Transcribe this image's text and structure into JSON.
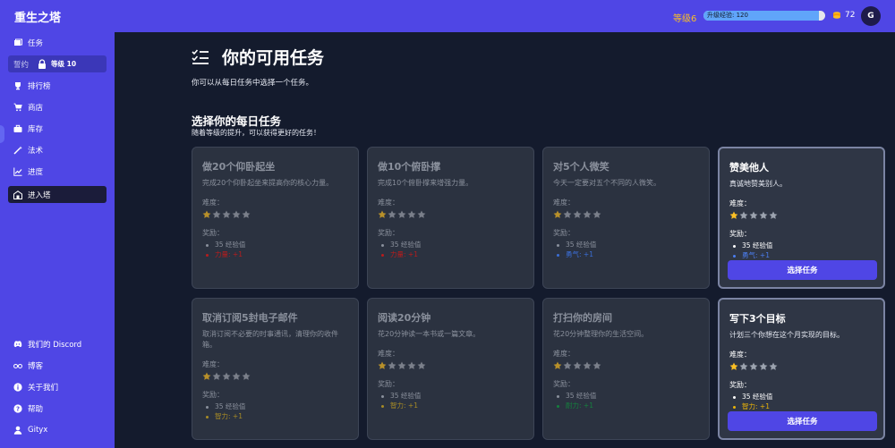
{
  "app": {
    "title": "重生之塔"
  },
  "header": {
    "level": "等级6",
    "xp_text": "升级经验: 120",
    "xp_progress": 0.95,
    "coins": "72",
    "avatar_initial": "G",
    "colors": {
      "bar": "#4f46e5",
      "level": "#fbbf24"
    }
  },
  "sidebar": {
    "items": [
      {
        "label": "任务",
        "icon": "tasks-icon"
      },
      {
        "label": "誓约",
        "icon": "lock-icon",
        "locked_level": "等级 10"
      },
      {
        "label": "排行榜",
        "icon": "trophy-icon"
      },
      {
        "label": "商店",
        "icon": "cart-icon"
      },
      {
        "label": "库存",
        "icon": "briefcase-icon"
      },
      {
        "label": "法术",
        "icon": "wand-icon"
      },
      {
        "label": "进度",
        "icon": "chart-icon"
      },
      {
        "label": "进入塔",
        "icon": "tower-icon"
      }
    ],
    "footer": [
      {
        "label": "我们的 Discord",
        "icon": "discord-icon"
      },
      {
        "label": "博客",
        "icon": "glasses-icon"
      },
      {
        "label": "关于我们",
        "icon": "info-icon"
      },
      {
        "label": "帮助",
        "icon": "help-icon"
      },
      {
        "label": "Gityx",
        "icon": "user-icon"
      }
    ]
  },
  "main": {
    "title": "你的可用任务",
    "subtitle": "你可以从每日任务中选择一个任务。",
    "section_title": "选择你的每日任务",
    "section_sub": "随着等级的提升，可以获得更好的任务！",
    "difficulty_label": "难度：",
    "reward_label": "奖励：",
    "choose_label": "选择任务",
    "quests": [
      {
        "title": "做20个仰卧起坐",
        "desc": "完成20个仰卧起坐来提高你的核心力量。",
        "difficulty": 1,
        "xp": "35 经验值",
        "attr": "力量: +1",
        "attr_color": "red",
        "available": false
      },
      {
        "title": "做10个俯卧撑",
        "desc": "完成10个俯卧撑来增强力量。",
        "difficulty": 1,
        "xp": "35 经验值",
        "attr": "力量: +1",
        "attr_color": "red",
        "available": false
      },
      {
        "title": "对5个人微笑",
        "desc": "今天一定要对五个不同的人微笑。",
        "difficulty": 1,
        "xp": "35 经验值",
        "attr": "勇气: +1",
        "attr_color": "blue",
        "available": false
      },
      {
        "title": "赞美他人",
        "desc": "真诚地赞美别人。",
        "difficulty": 1,
        "xp": "35 经验值",
        "attr": "勇气: +1",
        "attr_color": "blue",
        "available": true
      },
      {
        "title": "取消订阅5封电子邮件",
        "desc": "取消订阅不必要的时事通讯，清理你的收件箱。",
        "difficulty": 1,
        "xp": "35 经验值",
        "attr": "智力: +1",
        "attr_color": "yellow",
        "available": false
      },
      {
        "title": "阅读20分钟",
        "desc": "花20分钟读一本书或一篇文章。",
        "difficulty": 1,
        "xp": "35 经验值",
        "attr": "智力: +1",
        "attr_color": "yellow",
        "available": false
      },
      {
        "title": "打扫你的房间",
        "desc": "花20分钟整理你的生活空间。",
        "difficulty": 1,
        "xp": "35 经验值",
        "attr": "耐力: +1",
        "attr_color": "green",
        "available": false
      },
      {
        "title": "写下3个目标",
        "desc": "计划三个你想在这个月实现的目标。",
        "difficulty": 1,
        "xp": "35 经验值",
        "attr": "智力: +1",
        "attr_color": "yellow",
        "available": true
      }
    ]
  }
}
